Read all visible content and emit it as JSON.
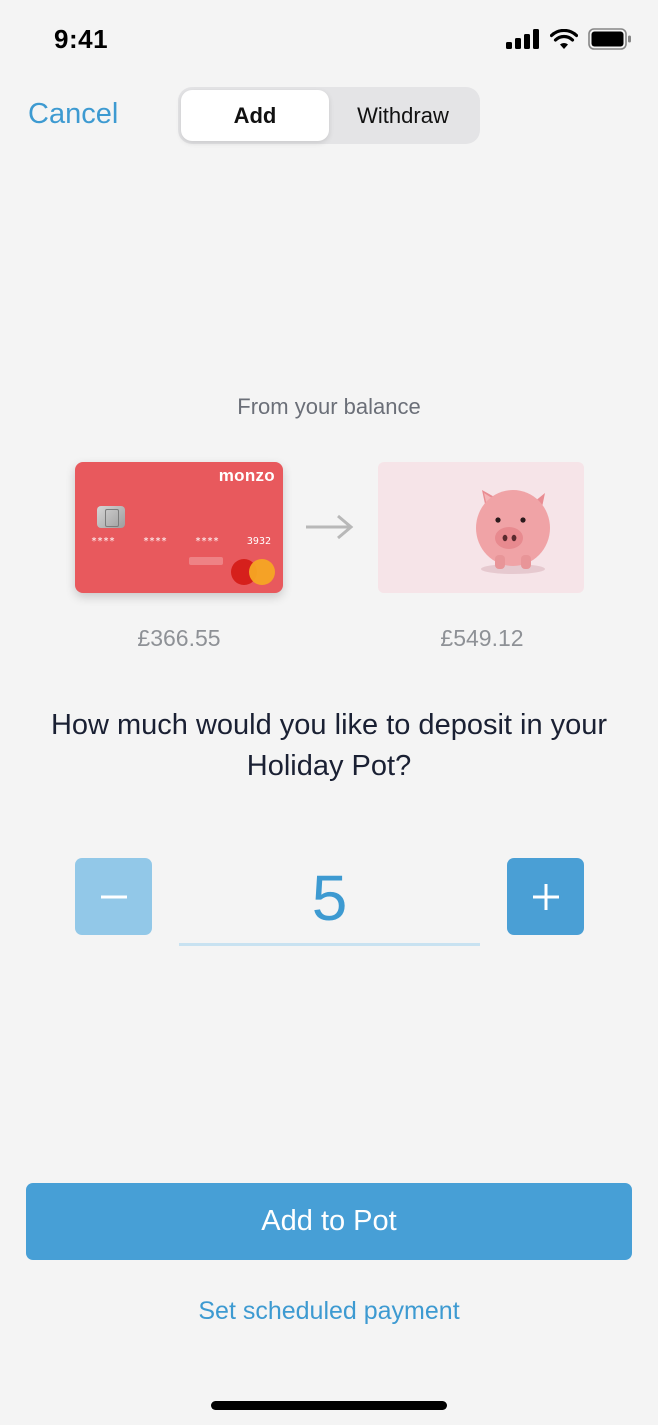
{
  "status_bar": {
    "time": "9:41"
  },
  "nav": {
    "cancel_label": "Cancel",
    "tabs": [
      {
        "label": "Add",
        "active": true
      },
      {
        "label": "Withdraw",
        "active": false
      }
    ]
  },
  "transfer": {
    "source_label": "From your balance",
    "card": {
      "brand": "monzo",
      "number_groups": [
        "****",
        "****",
        "****",
        "3932"
      ],
      "color": "#e8595d"
    },
    "card_balance": "£366.55",
    "pot_balance": "£549.12"
  },
  "question": "How much would you like to deposit in your Holiday Pot?",
  "stepper": {
    "value": "5"
  },
  "primary_button_label": "Add to Pot",
  "secondary_link_label": "Set scheduled payment",
  "colors": {
    "accent": "#3d9ad1",
    "card": "#e8595d"
  }
}
